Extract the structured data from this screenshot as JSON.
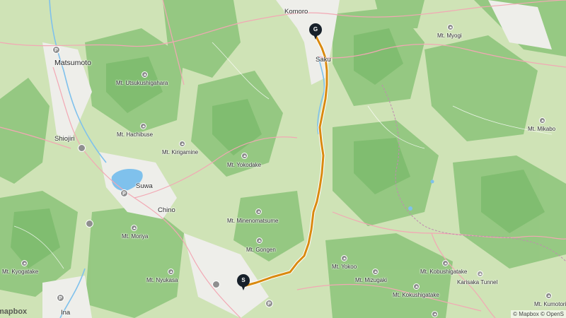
{
  "colors": {
    "mountain": "#cfe3b6",
    "forest": "#8cc47a",
    "urban": "#eeeeea",
    "water": "#7fc1ec",
    "road": "#f2a8b4",
    "route": "#d98a10",
    "pin": "#17202a"
  },
  "cities": {
    "matsumoto": "Matsumoto",
    "shiojiri": "Shiojiri",
    "suwa": "Suwa",
    "chino": "Chino",
    "komoro": "Komoro",
    "saku": "Saku",
    "ina": "Ina"
  },
  "peaks": {
    "utsukushigahara": "Mt. Utsukushigahara",
    "hachibuse": "Mt. Hachibuse",
    "kirigamine": "Mt. Kirigamine",
    "yokodake": "Mt. Yokodake",
    "minenomatsume": "Mt. Minenomatsume",
    "gongen": "Mt. Gongen",
    "moriya": "Mt. Moriya",
    "nyukasa": "Mt. Nyukasa",
    "kyogatake": "Mt. Kyogatake",
    "yokoo": "Mt. Yokoo",
    "mizugaki": "Mt. Mizugaki",
    "kokushigatake": "Mt. Kokushigatake",
    "kobushigatake": "Mt. Kobushigatake",
    "myogi": "Mt. Myogi",
    "mikabo": "Mt. Mikabo",
    "kumotori": "Mt. Kumotori"
  },
  "places": {
    "karisaka_tunnel": "Karisaka Tunnel"
  },
  "markers": {
    "start": "S",
    "goal": "G"
  },
  "map": {
    "logo": "mapbox",
    "attribution": "© Mapbox © OpenS"
  }
}
